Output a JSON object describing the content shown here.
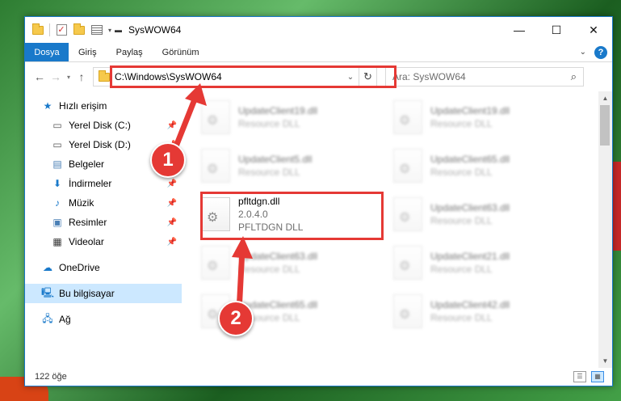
{
  "window": {
    "title": "SysWOW64",
    "controls": {
      "minimize": "—",
      "maximize": "☐",
      "close": "✕"
    }
  },
  "ribbon": {
    "file_tab": "Dosya",
    "tabs": [
      "Giriş",
      "Paylaş",
      "Görünüm"
    ],
    "help": "?"
  },
  "nav": {
    "address": "C:\\Windows\\SysWOW64",
    "search_placeholder": "Ara: SysWOW64"
  },
  "sidebar": {
    "items": [
      {
        "label": "Hızlı erişim",
        "icon": "star-icon"
      },
      {
        "label": "Yerel Disk (C:)",
        "icon": "drive-icon",
        "pinned": true
      },
      {
        "label": "Yerel Disk (D:)",
        "icon": "drive-icon",
        "pinned": true
      },
      {
        "label": "Belgeler",
        "icon": "documents-icon",
        "pinned": true
      },
      {
        "label": "İndirmeler",
        "icon": "downloads-icon",
        "pinned": true
      },
      {
        "label": "Müzik",
        "icon": "music-icon",
        "pinned": true
      },
      {
        "label": "Resimler",
        "icon": "pictures-icon",
        "pinned": true
      },
      {
        "label": "Videolar",
        "icon": "videos-icon",
        "pinned": true
      },
      {
        "label": "OneDrive",
        "icon": "cloud-icon"
      },
      {
        "label": "Bu bilgisayar",
        "icon": "computer-icon",
        "selected": true
      },
      {
        "label": "Ağ",
        "icon": "network-icon"
      }
    ]
  },
  "files": [
    {
      "name": "UpdateClient19.dll",
      "meta": "Resource DLL",
      "blurred": true
    },
    {
      "name": "UpdateClient19.dll",
      "meta": "Resource DLL",
      "blurred": true
    },
    {
      "name": "UpdateClient5.dll",
      "meta": "Resource DLL",
      "blurred": true
    },
    {
      "name": "UpdateClient65.dll",
      "meta": "Resource DLL",
      "blurred": true
    },
    {
      "name": "pfltdgn.dll",
      "version": "2.0.4.0",
      "meta": "PFLTDGN DLL",
      "blurred": false
    },
    {
      "name": "UpdateClient63.dll",
      "meta": "Resource DLL",
      "blurred": true
    },
    {
      "name": "UpdateClient63.dll",
      "meta": "Resource DLL",
      "blurred": true
    },
    {
      "name": "UpdateClient21.dll",
      "meta": "Resource DLL",
      "blurred": true
    },
    {
      "name": "UpdateClient65.dll",
      "meta": "Resource DLL",
      "blurred": true
    },
    {
      "name": "UpdateClient42.dll",
      "meta": "Resource DLL",
      "blurred": true
    }
  ],
  "status": {
    "count": "122 öğe"
  },
  "annotations": {
    "step1": "1",
    "step2": "2"
  },
  "colors": {
    "accent": "#1979ca",
    "highlight": "#e53935",
    "selected": "#cce8ff"
  }
}
